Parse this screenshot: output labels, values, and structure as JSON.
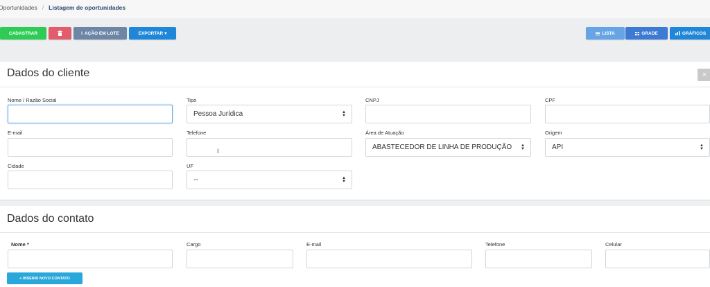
{
  "breadcrumb": {
    "parent": "Oportunidades",
    "separator": "/",
    "current": "Listagem de oportunidades"
  },
  "toolbar": {
    "cadastrar": "CADASTRAR",
    "delete_icon": "trash-icon",
    "acao_lote": "AÇÃO EM LOTE",
    "acao_lote_icon_text": "I",
    "exportar": "EXPORTAR",
    "exportar_caret": "▾",
    "lista": "LISTA",
    "grade": "GRADE",
    "graficos": "GRÁFICOS"
  },
  "cliente": {
    "title": "Dados do cliente",
    "close": "×",
    "labels": {
      "nome": "Nome / Razão Social",
      "tipo": "Tipo",
      "cnpj": "CNPJ",
      "cpf": "CPF",
      "email": "E-mail",
      "telefone": "Telefone",
      "area": "Área de Atuação",
      "origem": "Origem",
      "cidade": "Cidade",
      "uf": "UF"
    },
    "values": {
      "nome": "",
      "tipo": "Pessoa Jurídica",
      "cnpj": "",
      "cpf": "",
      "email": "",
      "telefone": "",
      "area": "ABASTECEDOR DE LINHA DE PRODUÇÃO",
      "origem": "API",
      "cidade": "",
      "uf": "--"
    }
  },
  "contato": {
    "title": "Dados do contato",
    "labels": {
      "nome": "Nome *",
      "cargo": "Cargo",
      "email": "E-mail",
      "telefone": "Telefone",
      "celular": "Celular"
    },
    "inserir": "+ INSERIR NOVO CONTATO"
  },
  "text_cursor": "I"
}
